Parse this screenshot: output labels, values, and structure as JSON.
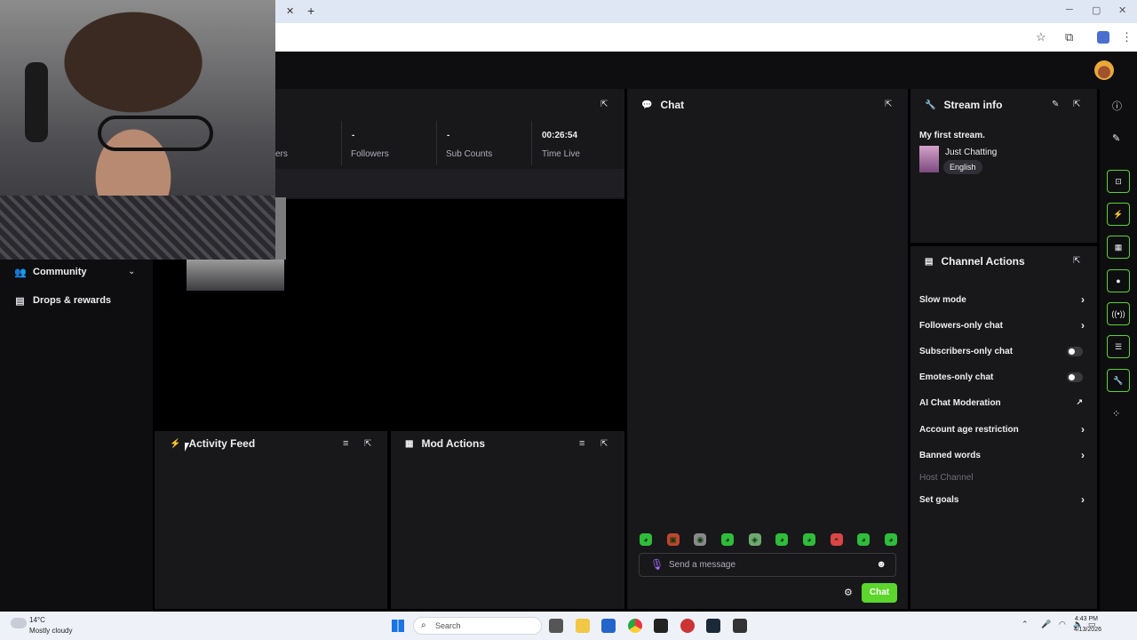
{
  "browser": {
    "tab_close": "✕",
    "tab_new": "+",
    "win_min": "─",
    "win_max": "▢",
    "win_close": "✕"
  },
  "sidebar": {
    "items": [
      {
        "label": "Community",
        "icon": "community-icon"
      },
      {
        "label": "Drops & rewards",
        "icon": "drops-icon"
      }
    ]
  },
  "stats": {
    "partial_label": "ers",
    "followers_value": "-",
    "followers_label": "Followers",
    "subs_value": "-",
    "subs_label": "Sub Counts",
    "time_value": "00:26:54",
    "time_label": "Time Live"
  },
  "chat": {
    "title": "Chat",
    "placeholder": "Send a message",
    "send_label": "Chat"
  },
  "stream_info": {
    "title": "Stream info",
    "stream_title": "My first stream.",
    "category": "Just Chatting",
    "tag": "English"
  },
  "channel_actions": {
    "title": "Channel Actions",
    "rows": [
      {
        "label": "Slow mode",
        "control": "chevron"
      },
      {
        "label": "Followers-only chat",
        "control": "chevron"
      },
      {
        "label": "Subscribers-only chat",
        "control": "toggle"
      },
      {
        "label": "Emotes-only chat",
        "control": "toggle"
      },
      {
        "label": "AI Chat Moderation",
        "control": "external"
      },
      {
        "label": "Account age restriction",
        "control": "chevron"
      },
      {
        "label": "Banned words",
        "control": "chevron"
      },
      {
        "label": "Host Channel",
        "control": "none"
      },
      {
        "label": "Set goals",
        "control": "chevron"
      }
    ]
  },
  "activity_feed": {
    "title": "Activity Feed"
  },
  "mod_actions": {
    "title": "Mod Actions"
  },
  "taskbar": {
    "temp": "14°C",
    "weather": "Mostly cloudy",
    "search": "Search",
    "time": "4:43 PM",
    "date": "4/13/2026"
  },
  "colors": {
    "accent_green": "#5cd62c",
    "panel_bg": "#18181b",
    "page_bg": "#0e0e10"
  }
}
